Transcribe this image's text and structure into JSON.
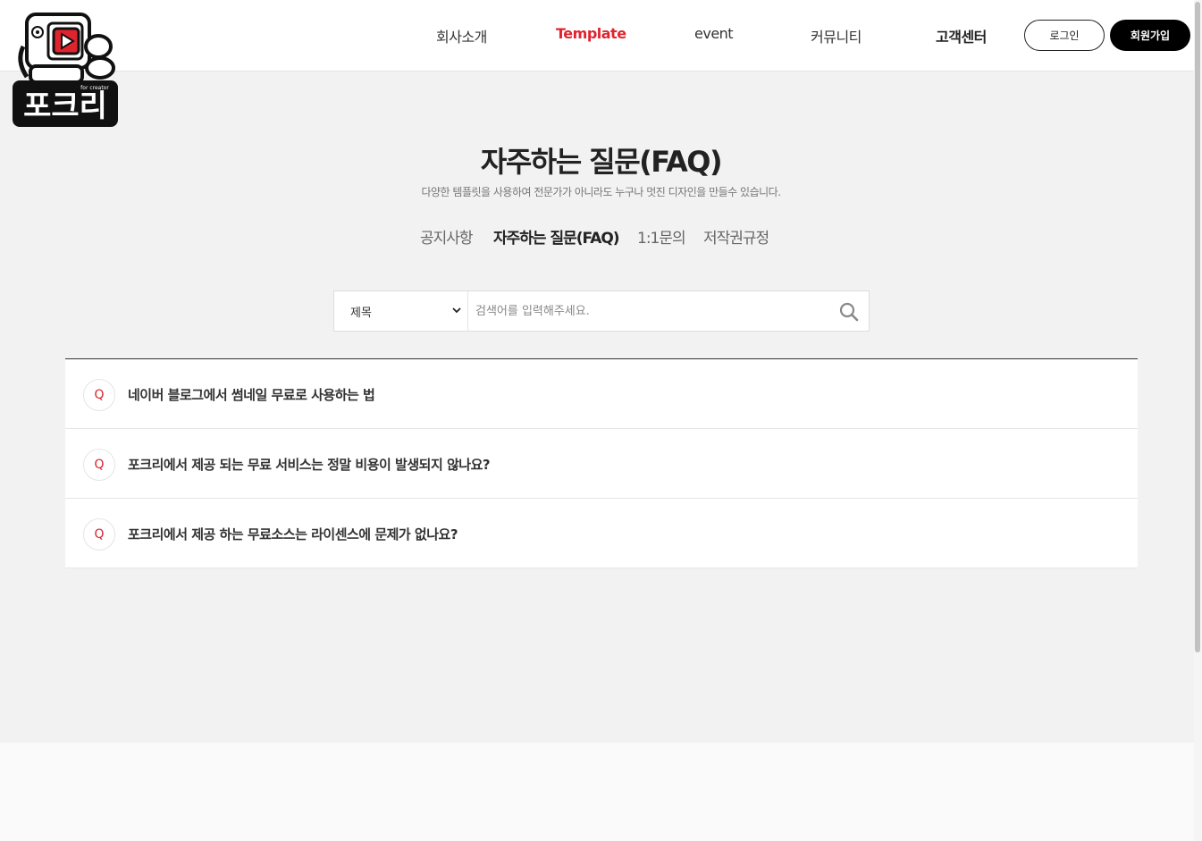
{
  "brand": {
    "logo_text": "포크리",
    "logo_sub": "for creator",
    "icon": "play-icon"
  },
  "nav": {
    "items": [
      {
        "label": "회사소개"
      },
      {
        "label": "Template"
      },
      {
        "label": "event"
      },
      {
        "label": "커뮤니티"
      },
      {
        "label": "고객센터"
      }
    ],
    "login_label": "로그인",
    "join_label": "회원가입"
  },
  "page": {
    "title": "자주하는 질문(FAQ)",
    "subtitle": "다양한 템플릿을 사용하여 전문가가 아니라도 누구나 멋진 디자인을 만들수 있습니다."
  },
  "tabs": [
    {
      "label": "공지사항"
    },
    {
      "label": "자주하는 질문(FAQ)"
    },
    {
      "label": "1:1문의"
    },
    {
      "label": "저작권규정"
    }
  ],
  "search": {
    "select_value": "제목",
    "placeholder": "검색어를 입력해주세요.",
    "icon": "search-icon"
  },
  "faq": {
    "marker": "Q",
    "items": [
      {
        "question": "네이버 블로그에서 썸네일 무료로 사용하는 법"
      },
      {
        "question": "포크리에서 제공 되는 무료 서비스는 정말 비용이 발생되지 않나요?"
      },
      {
        "question": "포크리에서 제공 하는 무료소스는 라이센스에 문제가 없나요?"
      }
    ]
  },
  "colors": {
    "accent": "#e0242f",
    "tab_underline": "#f05a5a",
    "join_button": "#000000"
  }
}
